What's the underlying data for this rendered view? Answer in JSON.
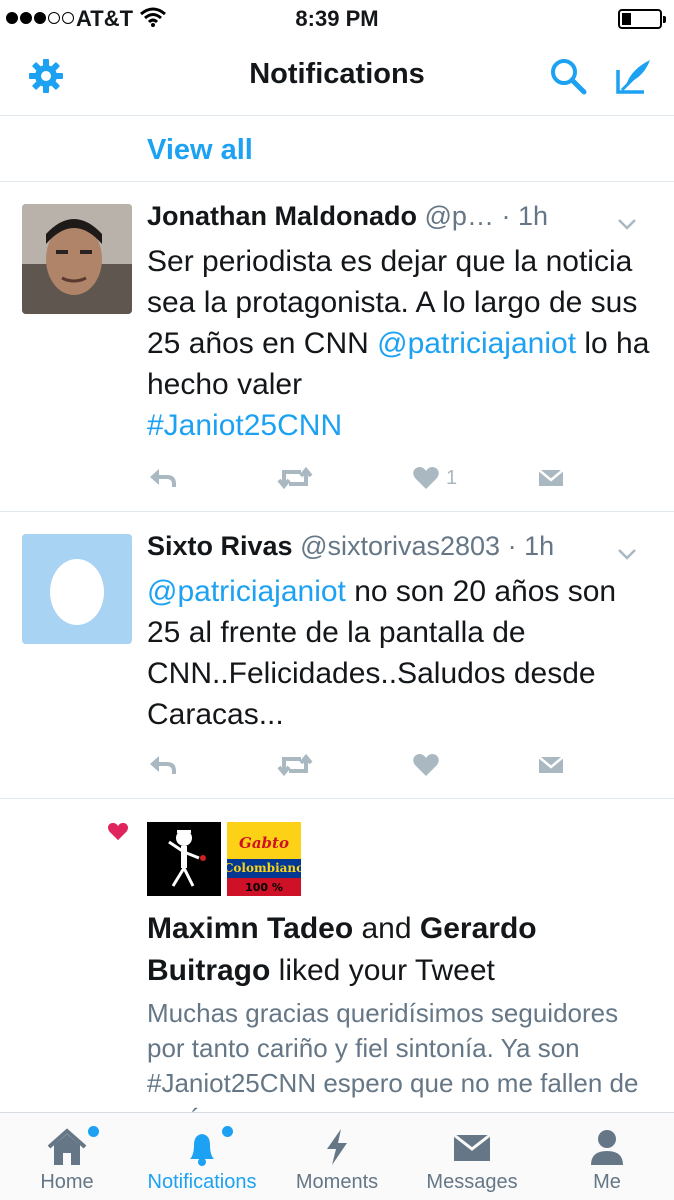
{
  "status_bar": {
    "carrier": "AT&T",
    "time": "8:39 PM"
  },
  "nav": {
    "title": "Notifications"
  },
  "view_all": "View all",
  "tweets": [
    {
      "author": "Jonathan Maldonado",
      "handle": "@p…",
      "time": "· 1h",
      "text_plain_1": "Ser periodista es dejar que la noticia sea la protagonista. A lo largo de sus 25 años en CNN ",
      "mention": "@patriciajaniot",
      "text_plain_2": " lo ha hecho valer ",
      "hashtag": "#Janiot25CNN",
      "like_count": "1"
    },
    {
      "author": "Sixto Rivas",
      "handle": "@sixtorivas2803",
      "time": "· 1h",
      "mention": "@patriciajaniot",
      "text_plain_1": " no son 20 años son 25 al frente de la pantalla de CNN..Felicidades..Saludos desde Caracas...",
      "like_count": ""
    }
  ],
  "notification": {
    "user1": "Maximn Tadeo",
    "conj": " and ",
    "user2": "Gerardo Buitrago",
    "action": " liked your Tweet",
    "quote": "Muchas gracias queridísimos seguidores por tanto cariño y fiel sintonía. Ya son #Janiot25CNN espero que no me fallen de aquí en",
    "badge_line1": "Gabto",
    "badge_line2": "Colombiano",
    "badge_line3": "100 %"
  },
  "tabs": [
    {
      "label": "Home",
      "icon": "home-icon"
    },
    {
      "label": "Notifications",
      "icon": "bell-icon"
    },
    {
      "label": "Moments",
      "icon": "lightning-icon"
    },
    {
      "label": "Messages",
      "icon": "envelope-icon"
    },
    {
      "label": "Me",
      "icon": "person-icon"
    }
  ],
  "colors": {
    "accent": "#1da1f2",
    "text": "#14171a",
    "muted": "#657786",
    "action_grey": "#aab8c2",
    "like_red": "#e0245e"
  }
}
